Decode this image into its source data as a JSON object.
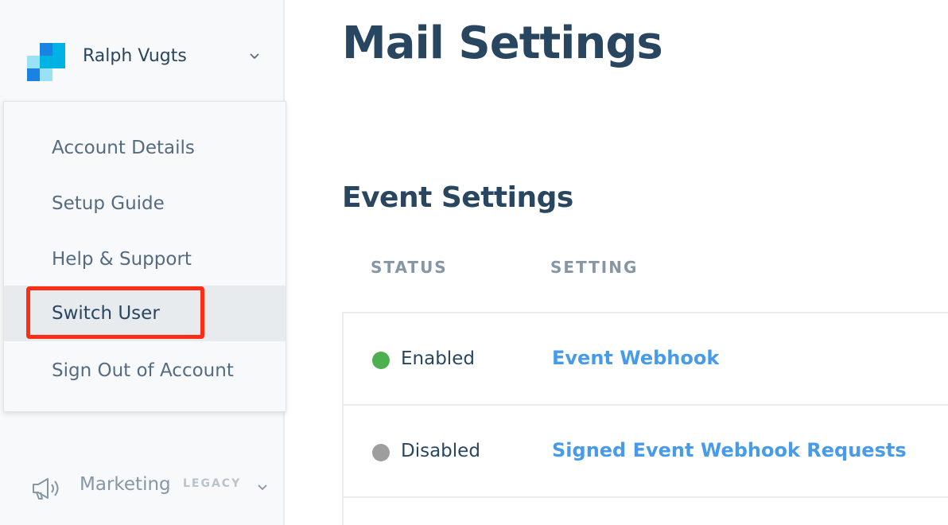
{
  "account": {
    "name": "Ralph Vugts",
    "logo_icon": "sendgrid-logo-icon",
    "chevron_icon": "chevron-down-icon"
  },
  "account_menu": {
    "items": [
      {
        "label": "Account Details"
      },
      {
        "label": "Setup Guide"
      },
      {
        "label": "Help & Support"
      },
      {
        "label": "Switch User",
        "highlighted": true
      },
      {
        "label": "Sign Out of Account"
      }
    ]
  },
  "sidebar": {
    "marketing": {
      "label": "Marketing",
      "badge": "LEGACY",
      "icon": "megaphone-icon",
      "chevron_icon": "chevron-down-icon"
    }
  },
  "page": {
    "title": "Mail Settings"
  },
  "event_settings": {
    "title": "Event Settings",
    "columns": [
      "STATUS",
      "SETTING"
    ],
    "rows": [
      {
        "status": "Enabled",
        "status_color": "#4caf50",
        "setting": "Event Webhook"
      },
      {
        "status": "Disabled",
        "status_color": "#9e9e9e",
        "setting": "Signed Event Webhook Requests"
      }
    ]
  },
  "colors": {
    "navy": "#294661",
    "link": "#489be8",
    "highlight_border": "#ff2d16",
    "muted": "#8796a5"
  }
}
